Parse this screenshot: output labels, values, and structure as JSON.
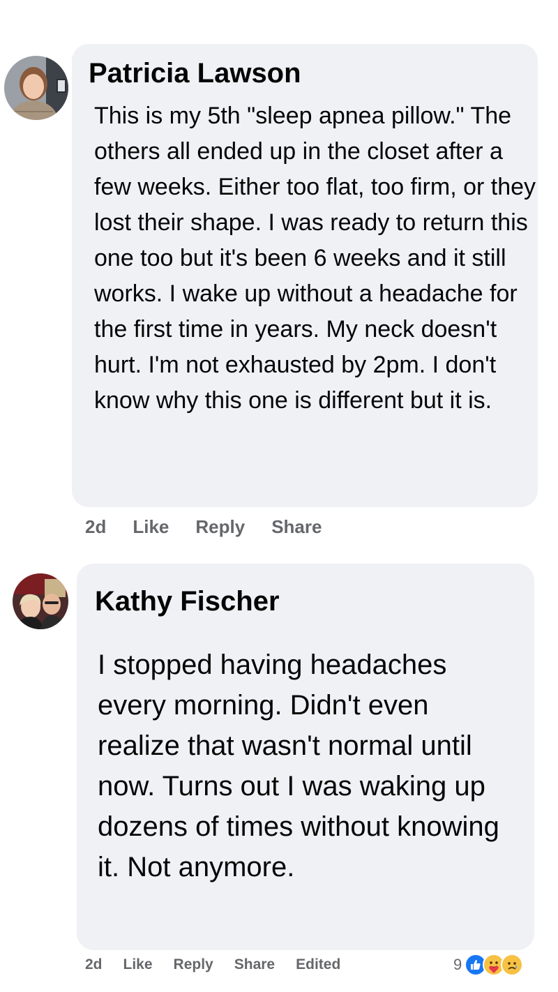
{
  "comments": [
    {
      "author": "Patricia Lawson",
      "text": "This is my 5th \"sleep apnea pillow.\" The others all ended up in the closet after a few weeks. Either too flat, too firm, or they lost their shape. I was ready to return this one too but it's been 6 weeks and it still works. I wake up without a headache for the first time in years. My neck doesn't hurt. I'm not exhausted by 2pm. I don't know why this one is different but it is.",
      "actions": {
        "time": "2d",
        "like": "Like",
        "reply": "Reply",
        "share": "Share"
      }
    },
    {
      "author": "Kathy Fischer",
      "text": "I stopped having headaches every morning. Didn't even realize that wasn't normal until now. Turns out I was waking up dozens of times without knowing it. Not anymore.",
      "actions": {
        "time": "2d",
        "like": "Like",
        "reply": "Reply",
        "share": "Share",
        "edited": "Edited"
      },
      "reactions": {
        "count": "9",
        "icons": [
          "like-icon",
          "care-icon",
          "sad-icon"
        ]
      }
    }
  ],
  "colors": {
    "bubble": "#f0f1f5",
    "meta": "#65676b",
    "like_blue": "#1877f2",
    "emoji_yellow": "#f7c144"
  }
}
